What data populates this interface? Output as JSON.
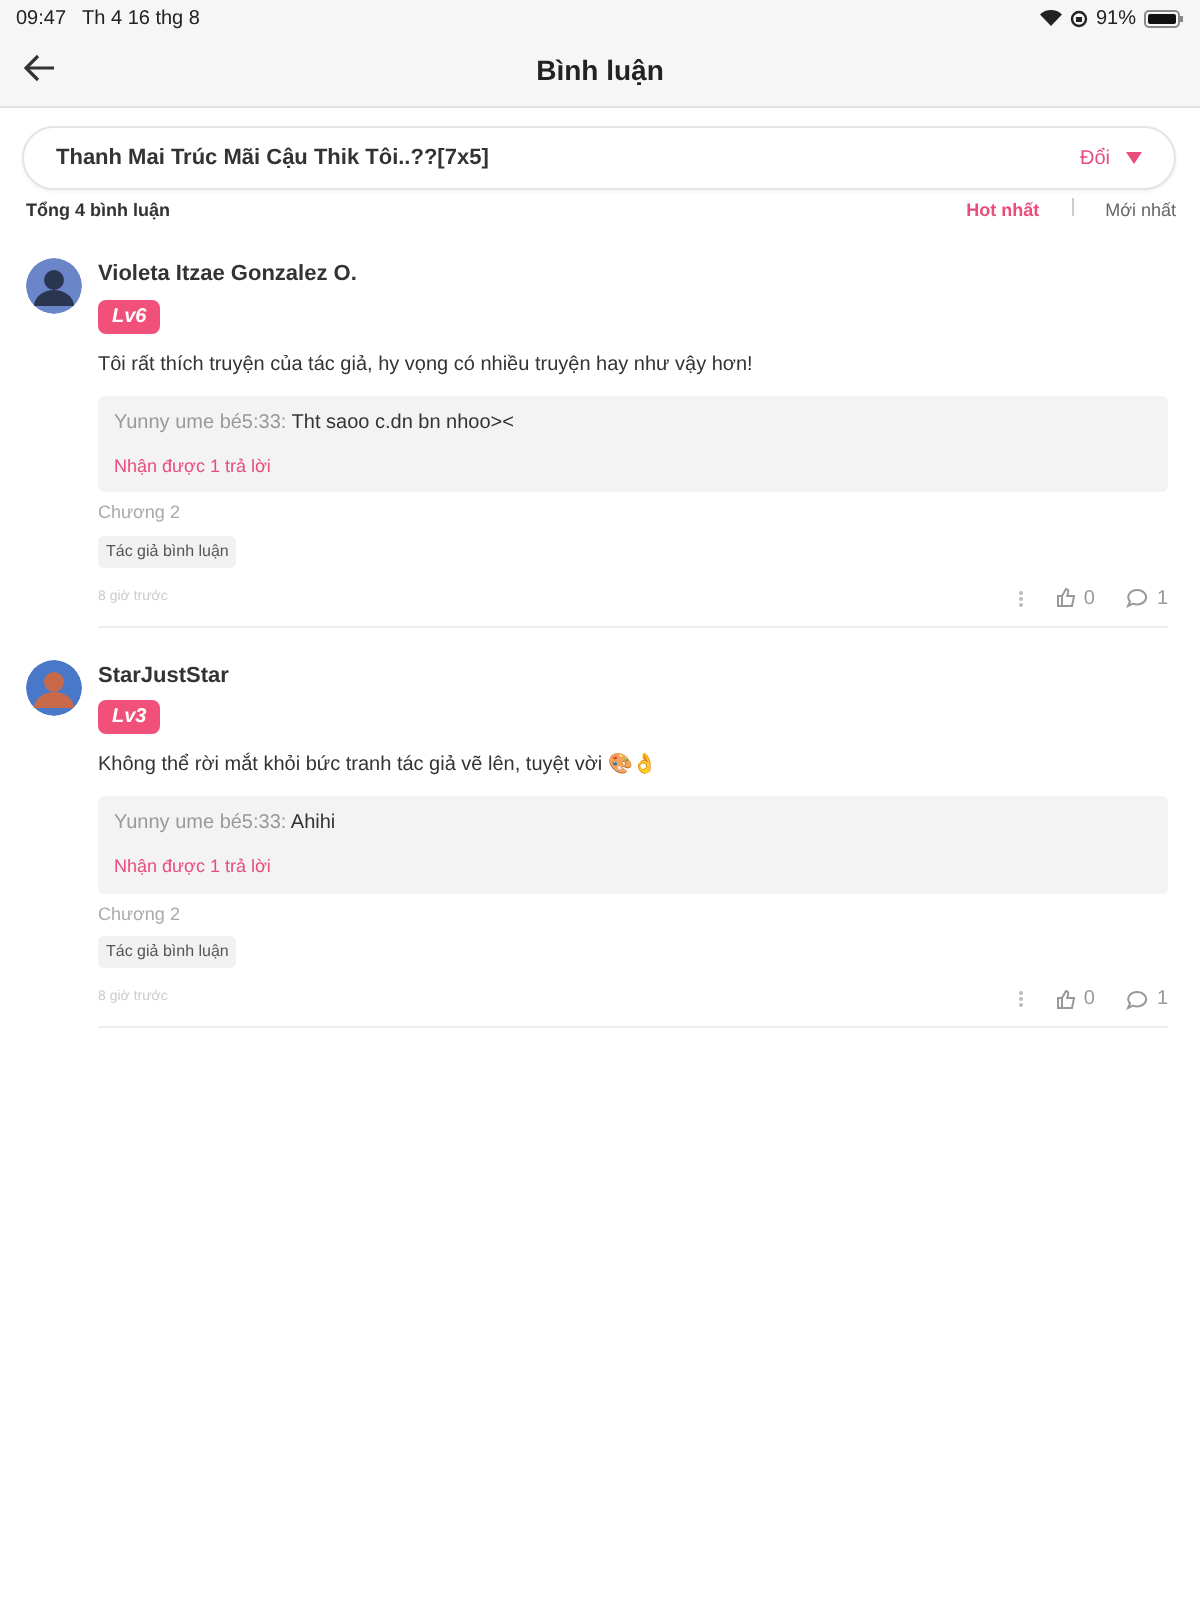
{
  "status_bar": {
    "time": "09:47",
    "date": "Th 4 16 thg 8",
    "battery": "91%"
  },
  "header": {
    "title": "Bình luận"
  },
  "chapter_selector": {
    "title": "Thanh Mai Trúc Mãi Cậu Thik Tôi..??[7x5]",
    "action": "Đổi"
  },
  "summary": {
    "total": "Tổng 4 bình luận",
    "sorts": [
      {
        "label": "Hot nhất",
        "selected": true
      },
      {
        "label": "Mới nhất",
        "selected": false
      }
    ]
  },
  "comments": [
    {
      "user": "Violeta Itzae Gonzalez O.",
      "level": "Lv6",
      "text": "Tôi rất thích truyện của tác giả, hy vọng có nhiều truyện hay như vậy hơn!",
      "reply": {
        "author": "Yunny ume bé5:33:",
        "text": "Tht saoo c.dn bn nhoo><",
        "more": "Nhận được 1 trả lời"
      },
      "chapter": "Chương 2",
      "tag": "Tác giả bình luận",
      "time": "8 giờ trước",
      "likes": "0",
      "replies": "1"
    },
    {
      "user": "StarJustStar",
      "level": "Lv3",
      "text": "Không thể rời mắt khỏi bức tranh tác giả vẽ lên, tuyệt vời 🎨👌",
      "reply": {
        "author": "Yunny ume bé5:33:",
        "text": "Ahihi",
        "more": "Nhận được 1 trả lời"
      },
      "chapter": "Chương 2",
      "tag": "Tác giả bình luận",
      "time": "8 giờ trước",
      "likes": "0",
      "replies": "1"
    }
  ]
}
